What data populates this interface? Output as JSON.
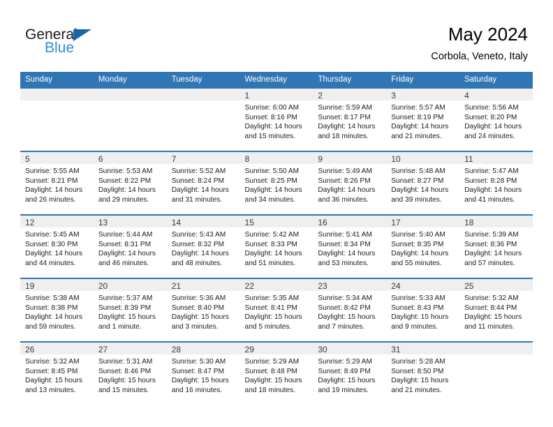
{
  "logo": {
    "word_top": "General",
    "word_bottom": "Blue",
    "triangle_color": "#1665b0",
    "blue_text_color": "#2a8fd8",
    "icon": "triangle-icon"
  },
  "header": {
    "title": "May 2024",
    "subtitle": "Corbola, Veneto, Italy"
  },
  "theme": {
    "header_row_bg": "#3075b4",
    "daynum_bg": "#efefef",
    "row_border": "#3075b4"
  },
  "calendar": {
    "weekday_headers": [
      "Sunday",
      "Monday",
      "Tuesday",
      "Wednesday",
      "Thursday",
      "Friday",
      "Saturday"
    ],
    "weeks": [
      [
        {
          "day": "",
          "empty": true,
          "sunrise": "",
          "sunset": "",
          "daylight_line1": "",
          "daylight_line2": ""
        },
        {
          "day": "",
          "empty": true,
          "sunrise": "",
          "sunset": "",
          "daylight_line1": "",
          "daylight_line2": ""
        },
        {
          "day": "",
          "empty": true,
          "sunrise": "",
          "sunset": "",
          "daylight_line1": "",
          "daylight_line2": ""
        },
        {
          "day": "1",
          "empty": false,
          "sunrise": "Sunrise: 6:00 AM",
          "sunset": "Sunset: 8:16 PM",
          "daylight_line1": "Daylight: 14 hours",
          "daylight_line2": "and 15 minutes."
        },
        {
          "day": "2",
          "empty": false,
          "sunrise": "Sunrise: 5:59 AM",
          "sunset": "Sunset: 8:17 PM",
          "daylight_line1": "Daylight: 14 hours",
          "daylight_line2": "and 18 minutes."
        },
        {
          "day": "3",
          "empty": false,
          "sunrise": "Sunrise: 5:57 AM",
          "sunset": "Sunset: 8:19 PM",
          "daylight_line1": "Daylight: 14 hours",
          "daylight_line2": "and 21 minutes."
        },
        {
          "day": "4",
          "empty": false,
          "sunrise": "Sunrise: 5:56 AM",
          "sunset": "Sunset: 8:20 PM",
          "daylight_line1": "Daylight: 14 hours",
          "daylight_line2": "and 24 minutes."
        }
      ],
      [
        {
          "day": "5",
          "empty": false,
          "sunrise": "Sunrise: 5:55 AM",
          "sunset": "Sunset: 8:21 PM",
          "daylight_line1": "Daylight: 14 hours",
          "daylight_line2": "and 26 minutes."
        },
        {
          "day": "6",
          "empty": false,
          "sunrise": "Sunrise: 5:53 AM",
          "sunset": "Sunset: 8:22 PM",
          "daylight_line1": "Daylight: 14 hours",
          "daylight_line2": "and 29 minutes."
        },
        {
          "day": "7",
          "empty": false,
          "sunrise": "Sunrise: 5:52 AM",
          "sunset": "Sunset: 8:24 PM",
          "daylight_line1": "Daylight: 14 hours",
          "daylight_line2": "and 31 minutes."
        },
        {
          "day": "8",
          "empty": false,
          "sunrise": "Sunrise: 5:50 AM",
          "sunset": "Sunset: 8:25 PM",
          "daylight_line1": "Daylight: 14 hours",
          "daylight_line2": "and 34 minutes."
        },
        {
          "day": "9",
          "empty": false,
          "sunrise": "Sunrise: 5:49 AM",
          "sunset": "Sunset: 8:26 PM",
          "daylight_line1": "Daylight: 14 hours",
          "daylight_line2": "and 36 minutes."
        },
        {
          "day": "10",
          "empty": false,
          "sunrise": "Sunrise: 5:48 AM",
          "sunset": "Sunset: 8:27 PM",
          "daylight_line1": "Daylight: 14 hours",
          "daylight_line2": "and 39 minutes."
        },
        {
          "day": "11",
          "empty": false,
          "sunrise": "Sunrise: 5:47 AM",
          "sunset": "Sunset: 8:28 PM",
          "daylight_line1": "Daylight: 14 hours",
          "daylight_line2": "and 41 minutes."
        }
      ],
      [
        {
          "day": "12",
          "empty": false,
          "sunrise": "Sunrise: 5:45 AM",
          "sunset": "Sunset: 8:30 PM",
          "daylight_line1": "Daylight: 14 hours",
          "daylight_line2": "and 44 minutes."
        },
        {
          "day": "13",
          "empty": false,
          "sunrise": "Sunrise: 5:44 AM",
          "sunset": "Sunset: 8:31 PM",
          "daylight_line1": "Daylight: 14 hours",
          "daylight_line2": "and 46 minutes."
        },
        {
          "day": "14",
          "empty": false,
          "sunrise": "Sunrise: 5:43 AM",
          "sunset": "Sunset: 8:32 PM",
          "daylight_line1": "Daylight: 14 hours",
          "daylight_line2": "and 48 minutes."
        },
        {
          "day": "15",
          "empty": false,
          "sunrise": "Sunrise: 5:42 AM",
          "sunset": "Sunset: 8:33 PM",
          "daylight_line1": "Daylight: 14 hours",
          "daylight_line2": "and 51 minutes."
        },
        {
          "day": "16",
          "empty": false,
          "sunrise": "Sunrise: 5:41 AM",
          "sunset": "Sunset: 8:34 PM",
          "daylight_line1": "Daylight: 14 hours",
          "daylight_line2": "and 53 minutes."
        },
        {
          "day": "17",
          "empty": false,
          "sunrise": "Sunrise: 5:40 AM",
          "sunset": "Sunset: 8:35 PM",
          "daylight_line1": "Daylight: 14 hours",
          "daylight_line2": "and 55 minutes."
        },
        {
          "day": "18",
          "empty": false,
          "sunrise": "Sunrise: 5:39 AM",
          "sunset": "Sunset: 8:36 PM",
          "daylight_line1": "Daylight: 14 hours",
          "daylight_line2": "and 57 minutes."
        }
      ],
      [
        {
          "day": "19",
          "empty": false,
          "sunrise": "Sunrise: 5:38 AM",
          "sunset": "Sunset: 8:38 PM",
          "daylight_line1": "Daylight: 14 hours",
          "daylight_line2": "and 59 minutes."
        },
        {
          "day": "20",
          "empty": false,
          "sunrise": "Sunrise: 5:37 AM",
          "sunset": "Sunset: 8:39 PM",
          "daylight_line1": "Daylight: 15 hours",
          "daylight_line2": "and 1 minute."
        },
        {
          "day": "21",
          "empty": false,
          "sunrise": "Sunrise: 5:36 AM",
          "sunset": "Sunset: 8:40 PM",
          "daylight_line1": "Daylight: 15 hours",
          "daylight_line2": "and 3 minutes."
        },
        {
          "day": "22",
          "empty": false,
          "sunrise": "Sunrise: 5:35 AM",
          "sunset": "Sunset: 8:41 PM",
          "daylight_line1": "Daylight: 15 hours",
          "daylight_line2": "and 5 minutes."
        },
        {
          "day": "23",
          "empty": false,
          "sunrise": "Sunrise: 5:34 AM",
          "sunset": "Sunset: 8:42 PM",
          "daylight_line1": "Daylight: 15 hours",
          "daylight_line2": "and 7 minutes."
        },
        {
          "day": "24",
          "empty": false,
          "sunrise": "Sunrise: 5:33 AM",
          "sunset": "Sunset: 8:43 PM",
          "daylight_line1": "Daylight: 15 hours",
          "daylight_line2": "and 9 minutes."
        },
        {
          "day": "25",
          "empty": false,
          "sunrise": "Sunrise: 5:32 AM",
          "sunset": "Sunset: 8:44 PM",
          "daylight_line1": "Daylight: 15 hours",
          "daylight_line2": "and 11 minutes."
        }
      ],
      [
        {
          "day": "26",
          "empty": false,
          "sunrise": "Sunrise: 5:32 AM",
          "sunset": "Sunset: 8:45 PM",
          "daylight_line1": "Daylight: 15 hours",
          "daylight_line2": "and 13 minutes."
        },
        {
          "day": "27",
          "empty": false,
          "sunrise": "Sunrise: 5:31 AM",
          "sunset": "Sunset: 8:46 PM",
          "daylight_line1": "Daylight: 15 hours",
          "daylight_line2": "and 15 minutes."
        },
        {
          "day": "28",
          "empty": false,
          "sunrise": "Sunrise: 5:30 AM",
          "sunset": "Sunset: 8:47 PM",
          "daylight_line1": "Daylight: 15 hours",
          "daylight_line2": "and 16 minutes."
        },
        {
          "day": "29",
          "empty": false,
          "sunrise": "Sunrise: 5:29 AM",
          "sunset": "Sunset: 8:48 PM",
          "daylight_line1": "Daylight: 15 hours",
          "daylight_line2": "and 18 minutes."
        },
        {
          "day": "30",
          "empty": false,
          "sunrise": "Sunrise: 5:29 AM",
          "sunset": "Sunset: 8:49 PM",
          "daylight_line1": "Daylight: 15 hours",
          "daylight_line2": "and 19 minutes."
        },
        {
          "day": "31",
          "empty": false,
          "sunrise": "Sunrise: 5:28 AM",
          "sunset": "Sunset: 8:50 PM",
          "daylight_line1": "Daylight: 15 hours",
          "daylight_line2": "and 21 minutes."
        },
        {
          "day": "",
          "empty": true,
          "sunrise": "",
          "sunset": "",
          "daylight_line1": "",
          "daylight_line2": ""
        }
      ]
    ]
  }
}
